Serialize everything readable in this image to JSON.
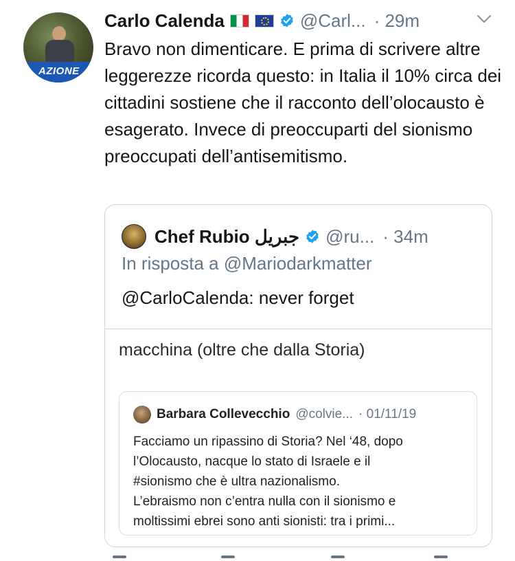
{
  "tweet": {
    "author_name": "Carlo Calenda",
    "avatar_badge_text": "AZIONE",
    "handle": "@Carl...",
    "time": "· 29m",
    "text": "Bravo non dimenticare. E prima di scrivere altre leggerezze ricorda questo: in Italia il 10% circa dei cittadini sostiene che il racconto dell’olocausto è esagerato. Invece di preoccuparti del sionismo preoccupati dell’antisemitismo."
  },
  "quoted_tweet": {
    "author_name": "Chef Rubio جبريل",
    "handle": "@ru...",
    "time": "· 34m",
    "reply_to": "In risposta a @Mariodarkmatter",
    "text": "@CarloCalenda: never forget",
    "media": {
      "top_line": "macchina (oltre che dalla Storia)",
      "embedded_tweet": {
        "author_name": "Barbara Collevecchio",
        "handle": "@colvie...",
        "date": "· 01/11/19",
        "lines": [
          "Facciamo un ripassino di Storia? Nel ‘48, dopo",
          "l’Olocausto, nacque lo stato di Israele e il",
          "#sionismo che è ultra nazionalismo.",
          "L’ebraismo non c’entra nulla con il sionismo e",
          "moltissimi ebrei sono anti sionisti:  tra i primi..."
        ]
      }
    }
  },
  "colors": {
    "verified": "#1da1f2",
    "muted": "#657786",
    "azione_blue": "#1d57b6"
  }
}
